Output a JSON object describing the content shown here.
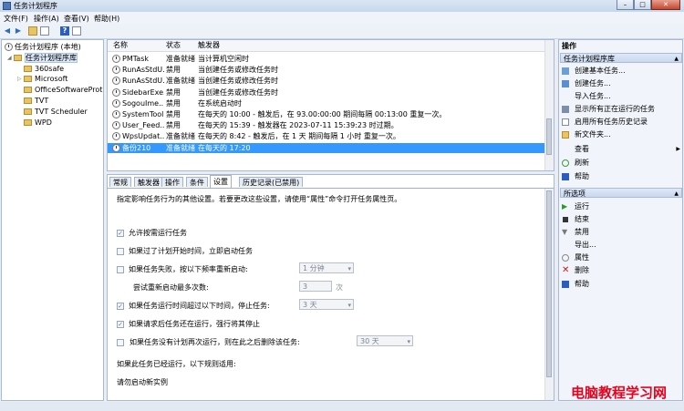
{
  "window": {
    "title": "任务计划程序"
  },
  "menu": [
    "文件(F)",
    "操作(A)",
    "查看(V)",
    "帮助(H)"
  ],
  "tree": {
    "root": "任务计划程序 (本地)",
    "library": "任务计划程序库",
    "folders": [
      "360safe",
      "Microsoft",
      "OfficeSoftwareProtecti",
      "TVT",
      "TVT Scheduler",
      "WPD"
    ]
  },
  "task_list": {
    "headers": {
      "name": "名称",
      "status": "状态",
      "trigger": "触发器"
    },
    "rows": [
      {
        "name": "PMTask",
        "status": "准备就绪",
        "trigger": "当计算机空闲时"
      },
      {
        "name": "RunAsStdU...",
        "status": "禁用",
        "trigger": "当创建任务或修改任务时"
      },
      {
        "name": "RunAsStdU...",
        "status": "准备就绪",
        "trigger": "当创建任务或修改任务时"
      },
      {
        "name": "SidebarExe...",
        "status": "禁用",
        "trigger": "当创建任务或修改任务时"
      },
      {
        "name": "SogouIme...",
        "status": "禁用",
        "trigger": "在系统启动时"
      },
      {
        "name": "SystemTool...",
        "status": "禁用",
        "trigger": "在每天的 10:00 - 触发后，在 93.00:00:00 期间每隔 00:13:00 重复一次。"
      },
      {
        "name": "User_Feed...",
        "status": "禁用",
        "trigger": "在每天的 15:39 - 触发器在 2023-07-11 15:39:23 时过期。"
      },
      {
        "name": "WpsUpdat...",
        "status": "准备就绪",
        "trigger": "在每天的 8:42 - 触发后，在 1 天 期间每隔 1 小时 重复一次。"
      },
      {
        "name": "备份210",
        "status": "准备就绪",
        "trigger": "在每天的 17:20"
      }
    ]
  },
  "details": {
    "tabs": [
      "常规",
      "触发器",
      "操作",
      "条件",
      "设置",
      "历史记录(已禁用)"
    ],
    "active_tab": "设置",
    "description": "指定影响任务行为的其他设置。若要更改这些设置，请使用“属性”命令打开任务属性页。",
    "options": {
      "allow_on_demand": "允许按需运行任务",
      "run_asap": "如果过了计划开始时间，立即启动任务",
      "restart_on_fail": "如果任务失败，按以下频率重新启动:",
      "restart_interval": "1 分钟",
      "retry_label": "尝试重新启动最多次数:",
      "retry_count": "3",
      "retry_unit": "次",
      "stop_if_longer": "如果任务运行时间超过以下时间，停止任务:",
      "stop_after": "3 天",
      "force_stop": "如果请求后任务还在运行，强行将其停止",
      "delete_if_not_scheduled": "如果任务没有计划再次运行，则在此之后删除该任务:",
      "delete_after": "30 天",
      "if_running_label": "如果此任务已经运行，以下规则适用:",
      "if_running_rule": "请勿启动新实例"
    }
  },
  "actions": {
    "header": "操作",
    "section1": {
      "title": "任务计划程序库",
      "items": [
        "创建基本任务...",
        "创建任务...",
        "导入任务...",
        "显示所有正在运行的任务",
        "启用所有任务历史记录",
        "新文件夹...",
        "查看",
        "刷新",
        "帮助"
      ]
    },
    "section2": {
      "title": "所选项",
      "items": [
        "运行",
        "结束",
        "禁用",
        "导出...",
        "属性",
        "删除",
        "帮助"
      ]
    }
  },
  "watermark": "电脑教程学习网"
}
